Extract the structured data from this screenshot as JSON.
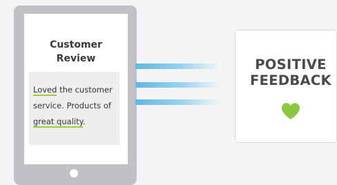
{
  "review": {
    "title_line1": "Customer",
    "title_line2": "Review",
    "text_parts": {
      "hl1": "Loved",
      "t1": " the customer",
      "t2": "service. Products of",
      "hl2": "great quality",
      "t3": "."
    }
  },
  "feedback": {
    "title_line1": "POSITIVE",
    "title_line2": "FEEDBACK",
    "icon": "heart-icon"
  },
  "colors": {
    "tablet_frame": "#bfc1c4",
    "highlight_underline": "#9ecb3c",
    "beam": "#5fb8e3",
    "heart": "#8dc63f"
  }
}
